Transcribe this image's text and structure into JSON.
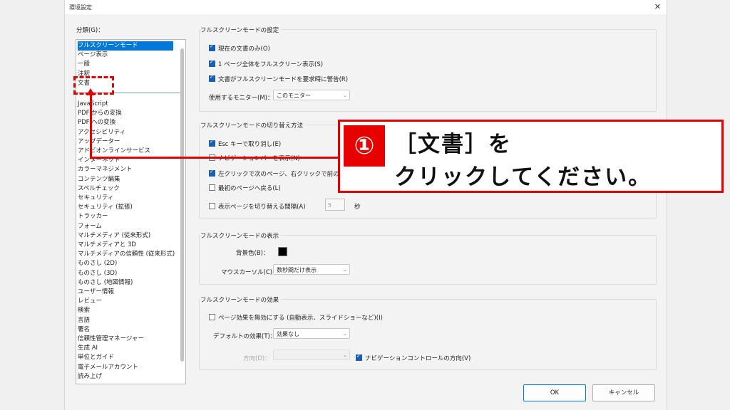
{
  "window": {
    "title": "環境設定",
    "close_glyph": "✕"
  },
  "category": {
    "label": "分類(G)：",
    "items": [
      "フルスクリーンモード",
      "ページ表示",
      "一般",
      "注釈",
      "文書",
      "JavaScript",
      "PDF からの変換",
      "PDF への変換",
      "アクセシビリティ",
      "アップデーター",
      "アドビオンラインサービス",
      "インターネット",
      "カラーマネジメント",
      "コンテンツ編集",
      "スペルチェック",
      "セキュリティ",
      "セキュリティ (拡張)",
      "トラッカー",
      "フォーム",
      "マルチメディア (従来形式)",
      "マルチメディアと 3D",
      "マルチメディアの信頼性 (従来形式)",
      "ものさし (2D)",
      "ものさし (3D)",
      "ものさし (地図情報)",
      "ユーザー情報",
      "レビュー",
      "検索",
      "言語",
      "署名",
      "信頼性管理マネージャー",
      "生成 AI",
      "単位とガイド",
      "電子メールアカウント",
      "読み上げ"
    ],
    "selected_index": 0
  },
  "setup": {
    "title": "フルスクリーンモードの設定",
    "cb_current_doc": "現在の文書のみ(O)",
    "cb_one_page": "1 ページ全体をフルスクリーン表示(S)",
    "cb_alert": "文書がフルスクリーンモードを要求時に警告(R)",
    "monitor_label": "使用するモニター(M)：",
    "monitor_value": "このモニター"
  },
  "navigation": {
    "title": "フルスクリーンモードの切り替え方法",
    "cb_esc": "Esc キーで取り消し(E)",
    "cb_navbar": "ナビゲーションバーを表示(N)",
    "cb_click": "左クリックで次のページ、右クリックで前のページを表示(F)",
    "cb_loop": "最初のページへ戻る(L)",
    "cb_advance": "表示ページを切り替える間隔(A)",
    "advance_value": "5",
    "seconds": "秒"
  },
  "appearance": {
    "title": "フルスクリーンモードの表示",
    "bg_label": "背景色(B)：",
    "bg_color": "#000000",
    "cursor_label": "マウスカーソル(C)：",
    "cursor_value": "数秒間だけ表示"
  },
  "transitions": {
    "title": "フルスクリーンモードの効果",
    "cb_ignore": "ページ効果を無効にする (自動表示、スライドショーなど)(I)",
    "default_label": "デフォルトの効果(T)：",
    "default_value": "効果なし",
    "direction_label": "方向(D)：",
    "cb_nav_direction": "ナビゲーションコントロールの方向(V)"
  },
  "buttons": {
    "ok": "OK",
    "cancel": "キャンセル"
  },
  "annotation": {
    "number": "①",
    "line1": "［文書］を",
    "line2": "クリックしてください。",
    "accent": "#e00000"
  }
}
